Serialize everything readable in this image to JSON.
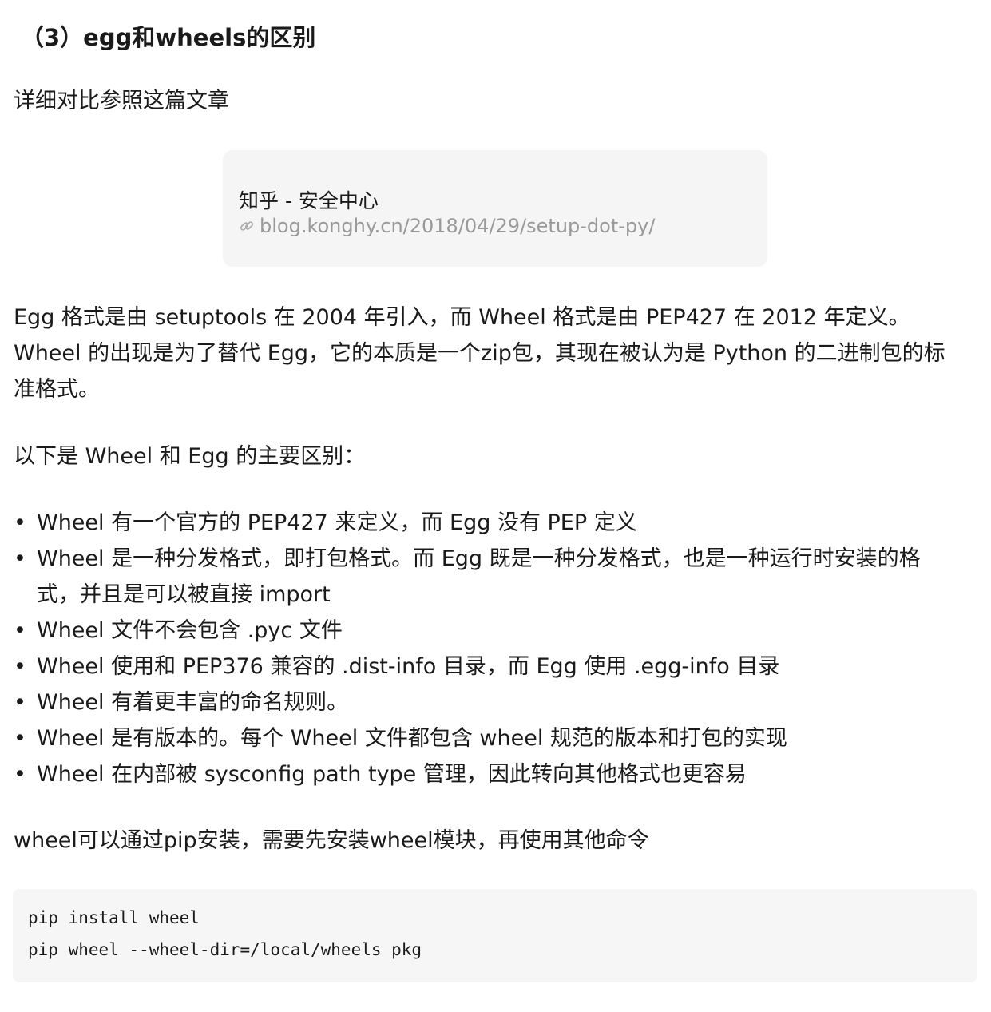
{
  "heading": "（3）egg和wheels的区别",
  "intro": "详细对比参照这篇文章",
  "link_card": {
    "title": "知乎 - 安全中心",
    "url": "blog.konghy.cn/2018/04/29/setup-dot-py/",
    "icon": "link-icon"
  },
  "paragraph1": [
    "Egg 格式是由 setuptools 在 2004 年引入，而 Wheel 格式是由 PEP427 在 2012 年定义。",
    "Wheel 的出现是为了替代 Egg，它的本质是一个zip包，其现在被认为是 Python 的二进制包的标",
    "准格式。"
  ],
  "list_intro": "以下是 Wheel 和 Egg 的主要区别：",
  "differences": [
    "Wheel 有一个官方的 PEP427 来定义，而 Egg 没有 PEP 定义",
    "Wheel 是一种分发格式，即打包格式。而 Egg 既是一种分发格式，也是一种运行时安装的格式，并且是可以被直接 import",
    "Wheel 文件不会包含 .pyc 文件",
    "Wheel 使用和 PEP376 兼容的 .dist-info 目录，而 Egg 使用 .egg-info 目录",
    "Wheel 有着更丰富的命名规则。",
    "Wheel 是有版本的。每个 Wheel 文件都包含 wheel 规范的版本和打包的实现",
    "Wheel 在内部被 sysconfig path type 管理，因此转向其他格式也更容易"
  ],
  "install_note": "wheel可以通过pip安装，需要先安装wheel模块，再使用其他命令",
  "code_lines": [
    "pip install wheel",
    "pip wheel --wheel-dir=/local/wheels pkg"
  ]
}
